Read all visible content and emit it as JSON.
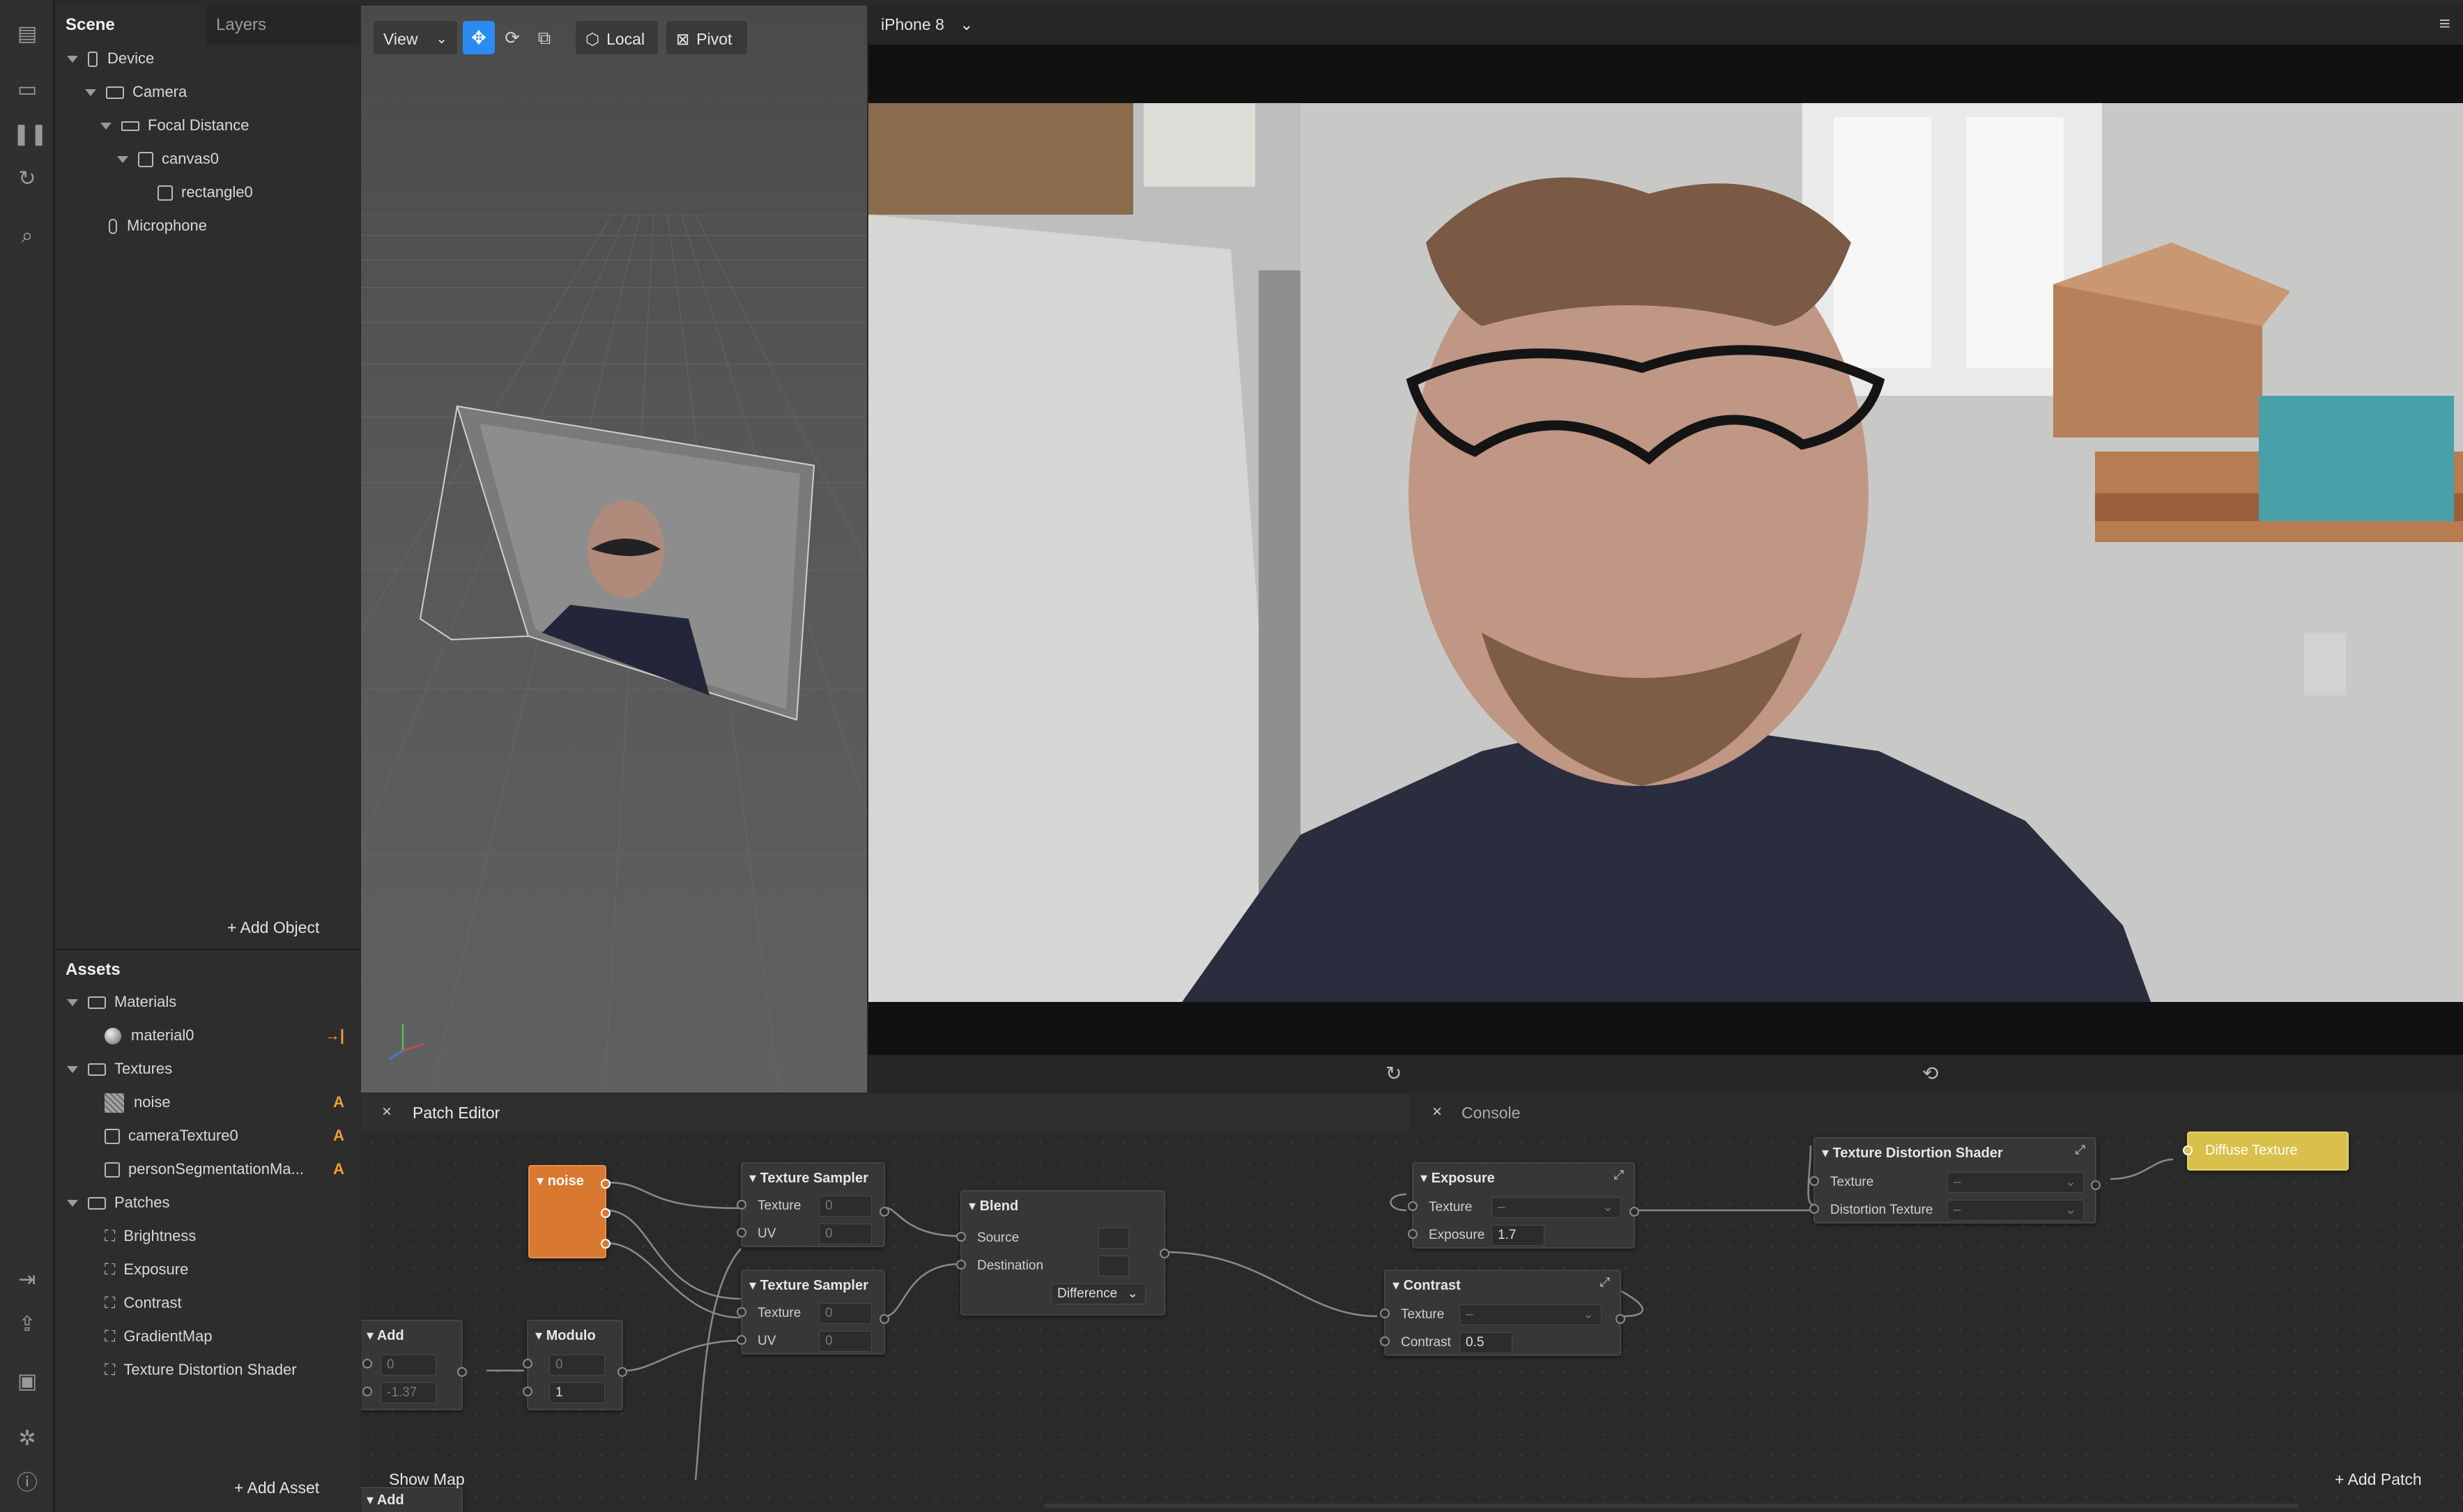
{
  "scene_panel": {
    "tabs": {
      "scene": "Scene",
      "layers": "Layers"
    },
    "tree": [
      {
        "label": "Device",
        "icon": "device-icon"
      },
      {
        "label": "Camera",
        "icon": "camera-icon"
      },
      {
        "label": "Focal Distance",
        "icon": "focal-distance-icon"
      },
      {
        "label": "canvas0",
        "icon": "canvas-icon"
      },
      {
        "label": "rectangle0",
        "icon": "rectangle-icon"
      },
      {
        "label": "Microphone",
        "icon": "microphone-icon"
      }
    ],
    "add_object": "+ Add Object"
  },
  "assets_panel": {
    "title": "Assets",
    "items": [
      {
        "label": "Materials",
        "icon": "folder-icon",
        "badge": ""
      },
      {
        "label": "material0",
        "icon": "material-sphere-icon",
        "badge": "→|"
      },
      {
        "label": "Textures",
        "icon": "folder-icon",
        "badge": ""
      },
      {
        "label": "noise",
        "icon": "noise-texture-icon",
        "badge": "A"
      },
      {
        "label": "cameraTexture0",
        "icon": "image-icon",
        "badge": "A"
      },
      {
        "label": "personSegmentationMa...",
        "icon": "image-icon",
        "badge": "A"
      },
      {
        "label": "Patches",
        "icon": "folder-icon",
        "badge": ""
      },
      {
        "label": "Brightness",
        "icon": "patch-icon",
        "badge": ""
      },
      {
        "label": "Exposure",
        "icon": "patch-icon",
        "badge": ""
      },
      {
        "label": "Contrast",
        "icon": "patch-icon",
        "badge": ""
      },
      {
        "label": "GradientMap",
        "icon": "patch-icon",
        "badge": ""
      },
      {
        "label": "Texture Distortion Shader",
        "icon": "patch-icon",
        "badge": ""
      }
    ],
    "add_asset": "+ Add Asset"
  },
  "viewport": {
    "view_label": "View",
    "local_label": "Local",
    "pivot_label": "Pivot"
  },
  "simulator": {
    "device": "iPhone 8"
  },
  "patch_editor": {
    "title": "Patch Editor",
    "console": "Console",
    "show_map": "Show Map",
    "add_patch": "+ Add Patch",
    "nodes": {
      "noise": {
        "title": "noise"
      },
      "ts1": {
        "title": "Texture Sampler",
        "texture_label": "Texture",
        "texture_val": "0",
        "uv_label": "UV",
        "uv_val": "0"
      },
      "ts2": {
        "title": "Texture Sampler",
        "texture_label": "Texture",
        "texture_val": "0",
        "uv_label": "UV",
        "uv_val": "0"
      },
      "blend": {
        "title": "Blend",
        "source_label": "Source",
        "dest_label": "Destination",
        "mode": "Difference"
      },
      "exposure": {
        "title": "Exposure",
        "texture_label": "Texture",
        "texture_val": "–",
        "exposure_label": "Exposure",
        "exposure_val": "1.7"
      },
      "contrast": {
        "title": "Contrast",
        "texture_label": "Texture",
        "texture_val": "–",
        "contrast_label": "Contrast",
        "contrast_val": "0.5"
      },
      "tds": {
        "title": "Texture Distortion Shader",
        "texture_label": "Texture",
        "texture_val": "–",
        "distortion_label": "Distortion Texture",
        "distortion_val": "–"
      },
      "diffuse": {
        "title": "Diffuse Texture"
      },
      "add1": {
        "title": "Add",
        "a": "0",
        "b": "-1.37"
      },
      "modulo": {
        "title": "Modulo",
        "a": "0",
        "b": "1"
      },
      "add2": {
        "title": "Add"
      }
    }
  },
  "colors": {
    "accent_blue": "#2a8cf0",
    "noise_orange": "#d9782f",
    "diffuse_yellow": "#d8c04a",
    "badge_orange": "#f0a030"
  }
}
